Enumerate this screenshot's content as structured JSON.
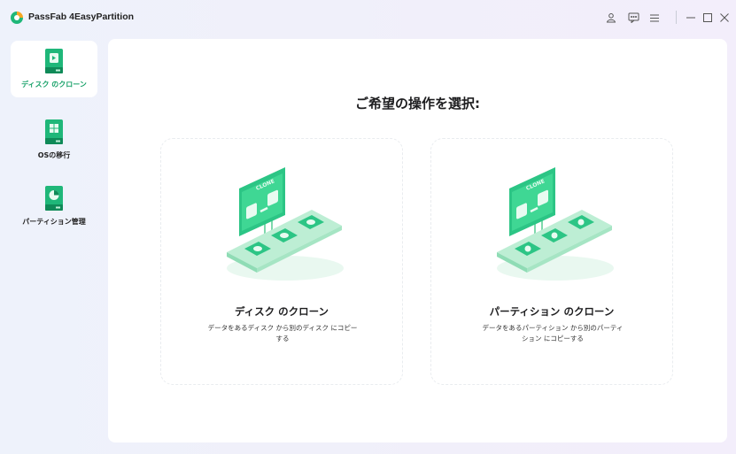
{
  "app": {
    "title": "PassFab 4EasyPartition",
    "brand_color": "#1fb779"
  },
  "titlebar": {
    "icons": [
      "user-icon",
      "feedback-icon",
      "menu-icon",
      "minimize-icon",
      "maximize-icon",
      "close-icon"
    ]
  },
  "sidebar": {
    "items": [
      {
        "label": "ディスク のクローン",
        "icon": "disk-clone-icon",
        "active": true
      },
      {
        "label": "OSの移行",
        "icon": "os-migration-icon",
        "active": false
      },
      {
        "label": "パーティション管理",
        "icon": "partition-management-icon",
        "active": false
      }
    ]
  },
  "main": {
    "title": "ご希望の操作を選択:",
    "cards": [
      {
        "title": "ディスク のクローン",
        "desc_line1": "データをあるディスク から別のディスク にコピー",
        "desc_line2": "する",
        "sign_text": "CLONE",
        "illustration": "disk-clone-illustration"
      },
      {
        "title": "パーティション のクローン",
        "desc_line1": "データをあるパーティション から別のパーティ",
        "desc_line2": "ション にコピーする",
        "sign_text": "CLONE",
        "illustration": "partition-clone-illustration"
      }
    ]
  }
}
